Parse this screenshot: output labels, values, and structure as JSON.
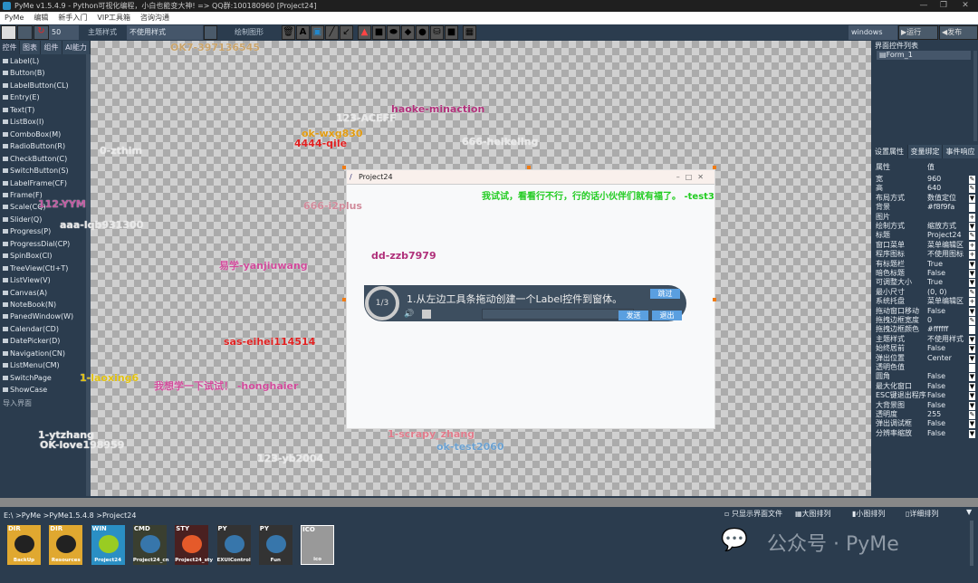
{
  "window": {
    "title": "PyMe v1.5.4.9 - Python可视化编程，小白也能变大神!  => QQ群:100180960   [Project24]",
    "min": "—",
    "max": "❐",
    "close": "✕"
  },
  "menu": [
    "PyMe",
    "编辑",
    "新手入门",
    "VIP工具箱",
    "咨询沟通"
  ],
  "toolbar": {
    "zoom_value": "50",
    "theme_label": "主题样式",
    "theme_value": "不使用样式",
    "draw_label": "绘制图形",
    "platform": "windows",
    "run": "▶运行",
    "publish": "◀发布"
  },
  "left": {
    "tabs": [
      "控件",
      "图表",
      "组件",
      "AI能力"
    ],
    "items": [
      "Label(L)",
      "Button(B)",
      "LabelButton(CL)",
      "Entry(E)",
      "Text(T)",
      "ListBox(I)",
      "ComboBox(M)",
      "RadioButton(R)",
      "CheckButton(C)",
      "SwitchButton(S)",
      "LabelFrame(CF)",
      "Frame(F)",
      "Scale(CQ)",
      "Slider(Q)",
      "Progress(P)",
      "ProgressDial(CP)",
      "SpinBox(CI)",
      "TreeView(Ctl+T)",
      "ListView(V)",
      "Canvas(A)",
      "NoteBook(N)",
      "PanedWindow(W)",
      "Calendar(CD)",
      "DatePicker(D)",
      "Navigation(CN)",
      "ListMenu(CM)",
      "SwitchPage",
      "ShowCase"
    ],
    "import": "导入界面"
  },
  "danmaku": [
    {
      "text": "OK7-397136545",
      "color": "#c9a36a"
    },
    {
      "text": "haoke-minaction",
      "color": "#b0307a"
    },
    {
      "text": "123-ACEFF",
      "color": "#e8e8e8"
    },
    {
      "text": "ok-wxg830",
      "color": "#e09a10"
    },
    {
      "text": "4444-qile",
      "color": "#e02020"
    },
    {
      "text": "666-heikeling",
      "color": "#e8e8e8"
    },
    {
      "text": "0-zthim",
      "color": "#e8e8e8"
    },
    {
      "text": "112-YYM",
      "color": "#c05aa0"
    },
    {
      "text": "666-i2plus",
      "color": "#d08a9a"
    },
    {
      "text": "aaa-lqb931300",
      "color": "#e8e8e8"
    },
    {
      "text": "易学-yanjiuwang",
      "color": "#d04a9a"
    },
    {
      "text": "sas-eihei114514",
      "color": "#e02020"
    },
    {
      "text": "1-laoxing6",
      "color": "#e0c010"
    },
    {
      "text": "我想学一下试试！ -honghaier",
      "color": "#d04a9a"
    },
    {
      "text": "1-ytzhang",
      "color": "#e8e8e8"
    },
    {
      "text": "OK-love198959",
      "color": "#e8e8e8"
    },
    {
      "text": "123-yb2004",
      "color": "#e8e8e8"
    },
    {
      "text": "1-scrapy_zhang",
      "color": "#e07a8a"
    },
    {
      "text": "ok-test2060",
      "color": "#6aa0d0"
    },
    {
      "text": "我试试，看看行不行，行的话小伙伴们就有福了。 -test3",
      "color": "#22cc22"
    },
    {
      "text": "dd-zzb7979",
      "color": "#b0307a"
    }
  ],
  "design": {
    "title": "Project24",
    "guide": {
      "step": "1/3",
      "text": "1.从左边工具条拖动创建一个Label控件到窗体。",
      "skip": "跳过",
      "send": "发送",
      "exit": "退出"
    }
  },
  "right": {
    "tree_title": "界面控件列表",
    "tree_items": [
      "Form_1"
    ],
    "tabs": [
      "设置属性",
      "变量绑定",
      "事件响应"
    ],
    "header": [
      "属性",
      "值"
    ],
    "props": [
      [
        "宽",
        "960",
        "✎"
      ],
      [
        "高",
        "640",
        "✎"
      ],
      [
        "布局方式",
        "数值定位",
        "▼"
      ],
      [
        "背景",
        "#f8f9fa",
        ""
      ],
      [
        "图片",
        "",
        "+"
      ],
      [
        "绘制方式",
        "缩放方式",
        "▼"
      ],
      [
        "标题",
        "Project24",
        "✎"
      ],
      [
        "窗口菜单",
        "菜单编辑区",
        "+"
      ],
      [
        "程序图标",
        "不使用图标",
        "+"
      ],
      [
        "有标题栏",
        "True",
        "▼"
      ],
      [
        "暗色标题",
        "False",
        "▼"
      ],
      [
        "可调整大小",
        "True",
        "▼"
      ],
      [
        "最小尺寸",
        "(0, 0)",
        "✎"
      ],
      [
        "系统托盘",
        "菜单编辑区",
        "+"
      ],
      [
        "拖动窗口移动",
        "False",
        "▼"
      ],
      [
        "拖拽边框宽度",
        "0",
        "✎"
      ],
      [
        "拖拽边框颜色",
        "#ffffff",
        ""
      ],
      [
        "主题样式",
        "不使用样式",
        "▼"
      ],
      [
        "始终居前",
        "False",
        "▼"
      ],
      [
        "弹出位置",
        "Center",
        "▼"
      ],
      [
        "透明色值",
        "",
        ""
      ],
      [
        "圆角",
        "False",
        "▼"
      ],
      [
        "最大化窗口",
        "False",
        "▼"
      ],
      [
        "ESC键退出程序",
        "False",
        "▼"
      ],
      [
        "大背景图",
        "False",
        "▼"
      ],
      [
        "透明度",
        "255",
        "✎"
      ],
      [
        "弹出调试框",
        "False",
        "▼"
      ],
      [
        "分辨率缩放",
        "False",
        "▼"
      ]
    ]
  },
  "bottom": {
    "path": "E:\\ >PyMe >PyMe1.5.4.8 >Project24",
    "only_ui": "只显示界面文件",
    "large": "大图排列",
    "small": "小图排列",
    "detail": "详细排列",
    "watermark": "公众号 · PyMe",
    "files": [
      {
        "type": "DIR",
        "name": "BackUp",
        "color": "#e0a830"
      },
      {
        "type": "DIR",
        "name": "Resources",
        "color": "#e0a830"
      },
      {
        "type": "WIN",
        "name": "Project24",
        "color": "#2a8fc4"
      },
      {
        "type": "CMD",
        "name": "Project24_cn",
        "color": "#3a3f30"
      },
      {
        "type": "STY",
        "name": "Project24_sty",
        "color": "#4a2020"
      },
      {
        "type": "PY",
        "name": "EXUIControl",
        "color": "#333"
      },
      {
        "type": "PY",
        "name": "Fun",
        "color": "#333"
      },
      {
        "type": "ICO",
        "name": "ico",
        "color": "#999"
      }
    ]
  }
}
